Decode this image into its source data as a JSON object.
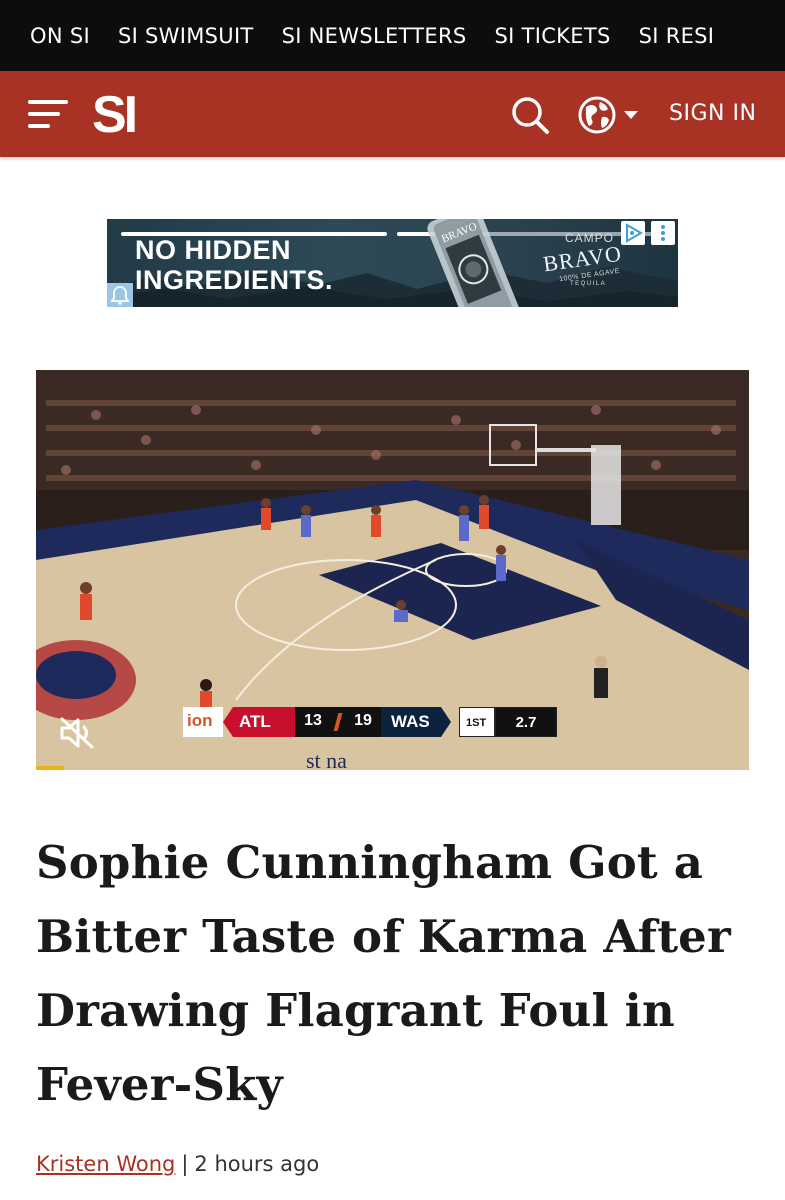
{
  "topnav": {
    "items": [
      "ON SI",
      "SI SWIMSUIT",
      "SI NEWSLETTERS",
      "SI TICKETS",
      "SI RESI"
    ]
  },
  "header": {
    "logo_text": "SI",
    "menu_icon": "hamburger-icon",
    "search_icon": "search-icon",
    "globe_icon": "globe-icon",
    "sign_in_label": "SIGN IN",
    "colors": {
      "brand": "#a83224",
      "topbar": "#0d0d0d"
    }
  },
  "ad": {
    "headline_line1": "NO HIDDEN",
    "headline_line2": "INGREDIENTS.",
    "brand_small": "CAMPO",
    "brand": "BRAVO",
    "brand_sub": "100% DE AGAVE",
    "brand_sub2": "TEQUILA",
    "bottle_label": "BRAVO"
  },
  "video": {
    "scorebug": {
      "network": "ion",
      "team1": "ATL",
      "score1": "13",
      "score2": "19",
      "team2": "WAS",
      "period": "1ST",
      "clock": "2.7"
    },
    "mute_icon": "muted-speaker-icon"
  },
  "article": {
    "title": "Sophie Cunningham Got a Bitter Taste of Karma After Drawing Flagrant Foul in Fever-Sky",
    "author": "Kristen Wong",
    "separator": "|",
    "time": "2 hours ago"
  }
}
